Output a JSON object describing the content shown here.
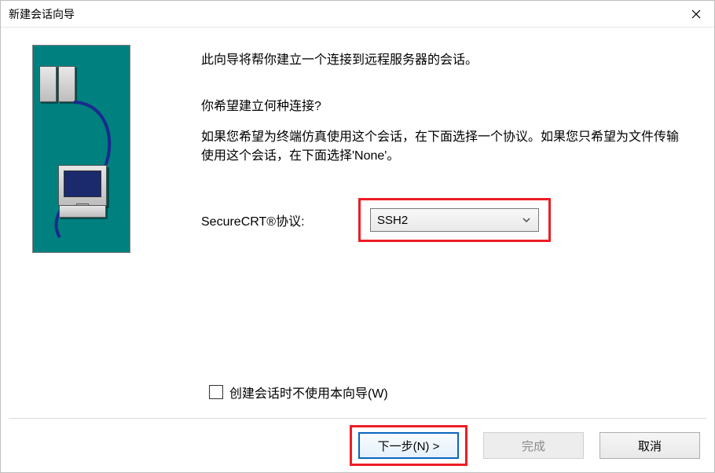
{
  "window": {
    "title": "新建会话向导"
  },
  "intro": "此向导将帮你建立一个连接到远程服务器的会话。",
  "question": "你希望建立何种连接?",
  "hint": "如果您希望为终端仿真使用这个会话，在下面选择一个协议。如果您只希望为文件传输使用这个会话，在下面选择'None'。",
  "protocol": {
    "label": "SecureCRT®协议:",
    "value": "SSH2"
  },
  "checkbox": {
    "label": "创建会话时不使用本向导(W)",
    "checked": false
  },
  "buttons": {
    "next": "下一步(N) >",
    "finish": "完成",
    "cancel": "取消"
  }
}
